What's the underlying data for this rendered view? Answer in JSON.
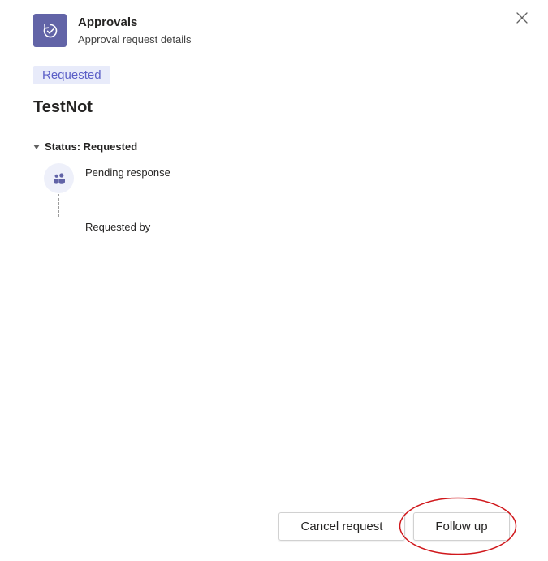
{
  "header": {
    "app_title": "Approvals",
    "app_subtitle": "Approval request details",
    "app_icon": "approvals-icon",
    "close_icon": "close-icon",
    "accent_color": "#6264a7"
  },
  "request": {
    "status_badge": "Requested",
    "title": "TestNot"
  },
  "status_section": {
    "label": "Status: Requested",
    "expanded": true,
    "timeline": {
      "pending_text": "Pending response",
      "requested_by_label": "Requested by",
      "avatar_icon": "people-icon"
    }
  },
  "footer": {
    "cancel_label": "Cancel request",
    "follow_up_label": "Follow up",
    "highlight_color": "#d0181c"
  }
}
